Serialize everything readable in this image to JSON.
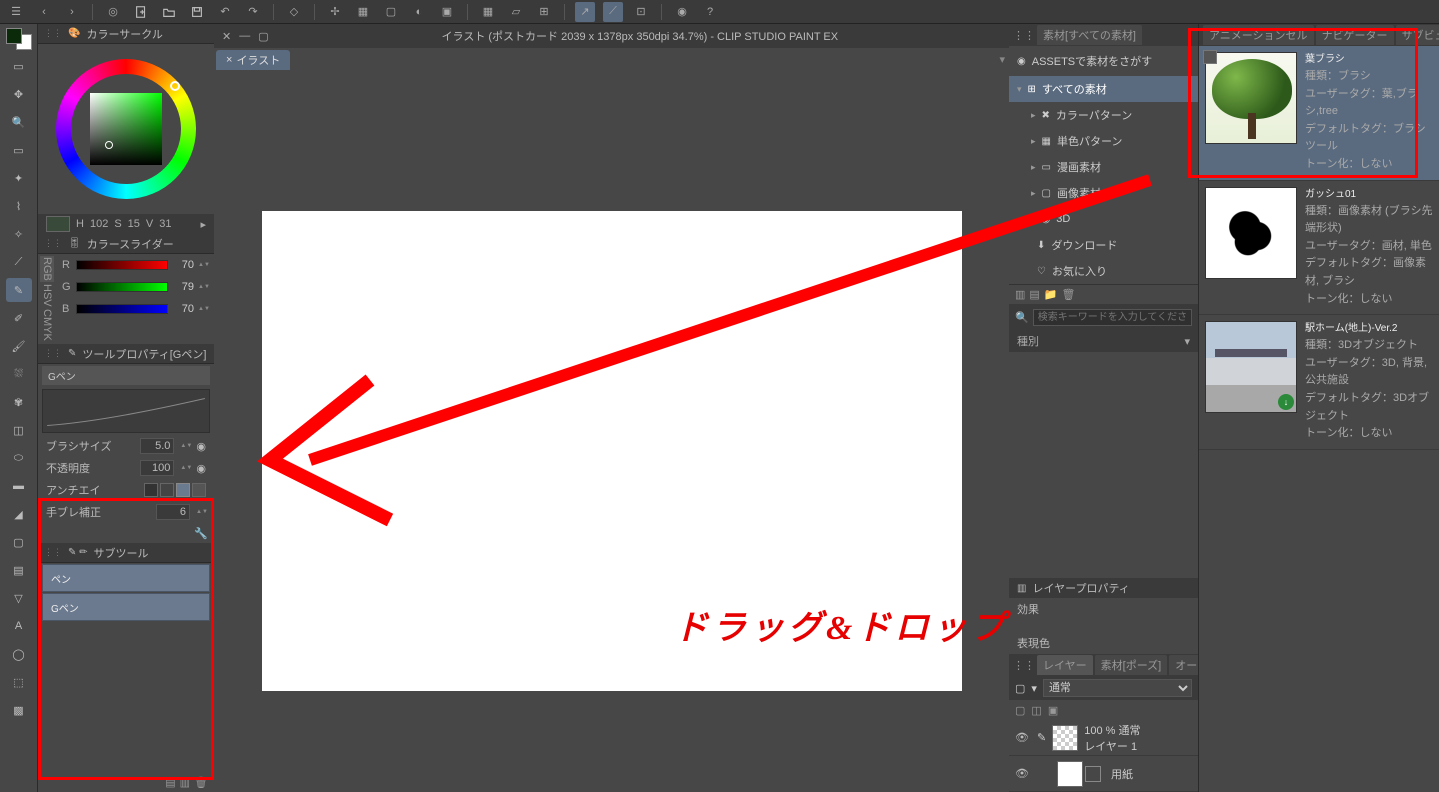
{
  "app": {
    "doc_title": "イラスト (ポストカード 2039 x 1378px 350dpi 34.7%)  -  CLIP STUDIO PAINT EX",
    "tab_label": "イラスト"
  },
  "panels": {
    "color_circle": "カラーサークル",
    "color_slider": "カラースライダー",
    "tool_property": "ツールプロパティ[Gペン]",
    "sub_tool": "サブツール"
  },
  "color_readout": {
    "h_label": "H",
    "h": "102",
    "s_label": "S",
    "s": "15",
    "v_label": "V",
    "v": "31"
  },
  "sliders": {
    "tabs": [
      "RGB",
      "HSV",
      "CMYK"
    ],
    "rows": [
      {
        "label": "R",
        "value": "70"
      },
      {
        "label": "G",
        "value": "79"
      },
      {
        "label": "B",
        "value": "70"
      }
    ]
  },
  "tool_props": {
    "name": "Gペン",
    "brush_size_label": "ブラシサイズ",
    "brush_size": "5.0",
    "opacity_label": "不透明度",
    "opacity": "100",
    "aa_label": "アンチエイ",
    "stab_label": "手ブレ補正",
    "stab": "6"
  },
  "subtools": [
    "ペン",
    "Gペン"
  ],
  "annotation": {
    "text": "ドラッグ&ドロップ"
  },
  "materials": {
    "panel_tab": "素材[すべての素材]",
    "right_tabs": [
      "アニメーションセル",
      "ナビゲーター",
      "サブビュ"
    ],
    "assets_label": "ASSETSで素材をさがす",
    "search_placeholder": "検索キーワードを入力してください",
    "type_label": "種別",
    "tree": [
      {
        "label": "すべての素材",
        "sel": true
      },
      {
        "label": "カラーパターン"
      },
      {
        "label": "単色パターン"
      },
      {
        "label": "漫画素材"
      },
      {
        "label": "画像素材"
      },
      {
        "label": "3D"
      },
      {
        "label": "ダウンロード"
      },
      {
        "label": "お気に入り"
      }
    ],
    "cards": [
      {
        "title": "葉ブラシ",
        "type": "種類：ブラシ",
        "user": "ユーザータグ：葉,ブラシ,tree",
        "def": "デフォルトタグ：ブラシツール",
        "tone": "トーン化：しない",
        "sel": true,
        "thumb": "tree",
        "check": true
      },
      {
        "title": "ガッシュ01",
        "type": "種類：画像素材 (ブラシ先端形状)",
        "user": "ユーザータグ：画材, 単色",
        "def": "デフォルトタグ：画像素材, ブラシ",
        "tone": "トーン化：しない",
        "thumb": "brush"
      },
      {
        "title": "駅ホーム(地上)-Ver.2",
        "type": "種類：3Dオブジェクト",
        "user": "ユーザータグ：3D, 背景, 公共施設",
        "def": "デフォルトタグ：3Dオブジェクト",
        "tone": "トーン化：しない",
        "thumb": "station",
        "dl": true
      }
    ]
  },
  "layer_prop": {
    "header": "レイヤープロパティ",
    "effect": "効果",
    "color": "表現色"
  },
  "layers": {
    "header": "レイヤー",
    "tabs": [
      "素材[ポーズ]",
      "オートアクション"
    ],
    "blend": "通常",
    "rows": [
      {
        "name": "レイヤー 1",
        "opacity": "100 % 通常",
        "checker": true
      },
      {
        "name": "用紙",
        "opacity": "",
        "checker": false
      }
    ]
  }
}
